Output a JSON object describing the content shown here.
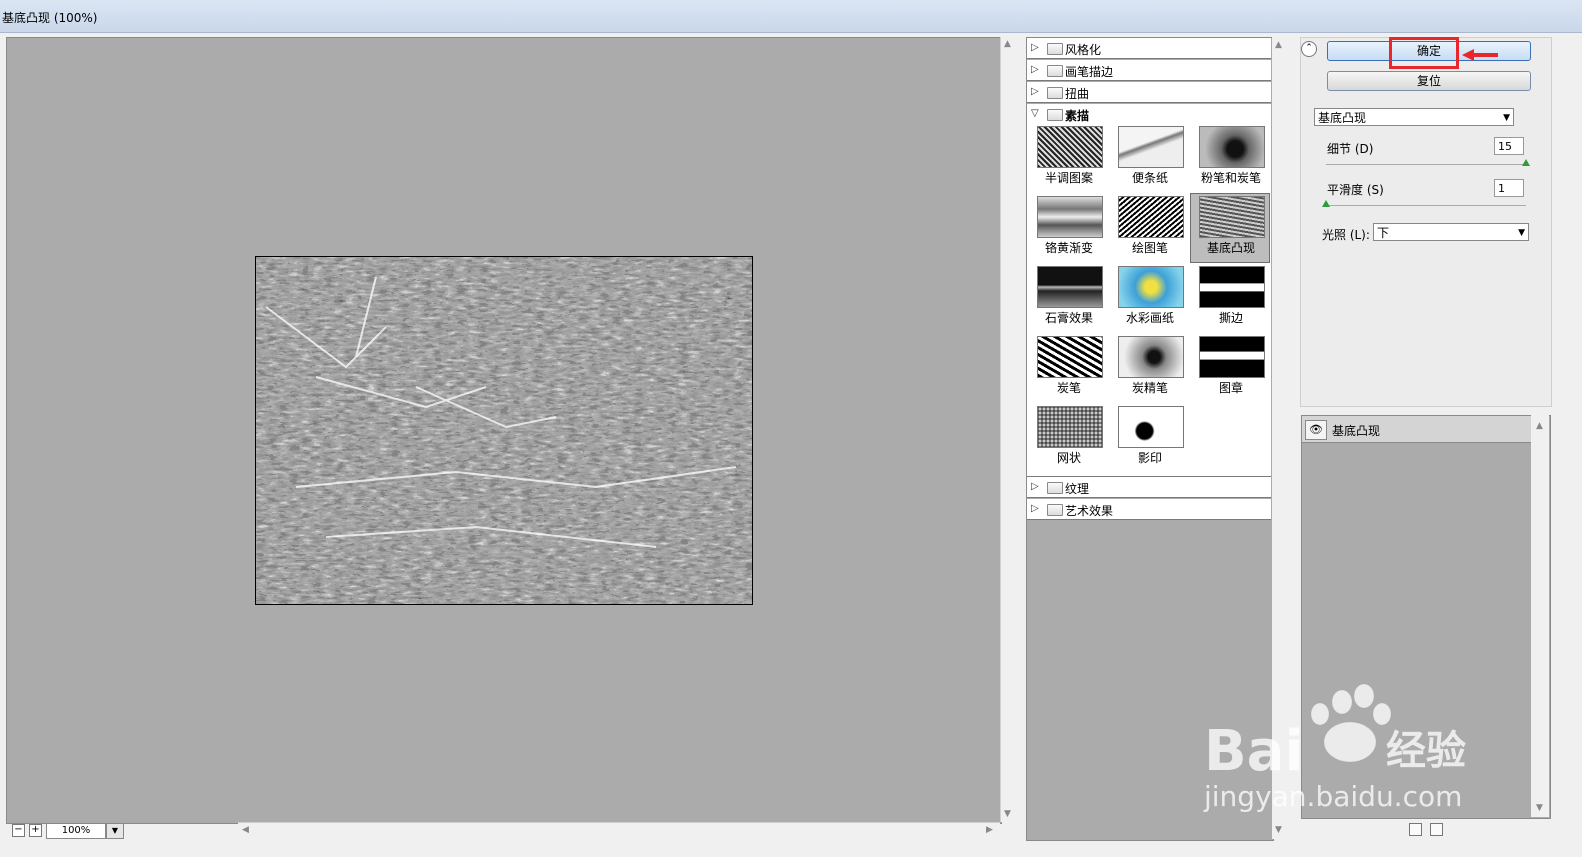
{
  "window": {
    "title": "基底凸现 (100%)"
  },
  "preview": {
    "zoom": "100%"
  },
  "gallery": {
    "categories_top": [
      "风格化",
      "画笔描边",
      "扭曲"
    ],
    "open_category": "素描",
    "thumbnails": [
      {
        "label": "半调图案",
        "icon": "halftone-thumb"
      },
      {
        "label": "便条纸",
        "icon": "notepaper-thumb"
      },
      {
        "label": "粉笔和炭笔",
        "icon": "chalk-charcoal-thumb"
      },
      {
        "label": "铬黄渐变",
        "icon": "chrome-thumb"
      },
      {
        "label": "绘图笔",
        "icon": "graphic-pen-thumb"
      },
      {
        "label": "基底凸现",
        "icon": "bas-relief-thumb",
        "selected": true
      },
      {
        "label": "石膏效果",
        "icon": "plaster-thumb"
      },
      {
        "label": "水彩画纸",
        "icon": "water-paper-thumb"
      },
      {
        "label": "撕边",
        "icon": "torn-edges-thumb"
      },
      {
        "label": "炭笔",
        "icon": "charcoal-thumb"
      },
      {
        "label": "炭精笔",
        "icon": "conte-crayon-thumb"
      },
      {
        "label": "图章",
        "icon": "stamp-thumb"
      },
      {
        "label": "网状",
        "icon": "reticulation-thumb"
      },
      {
        "label": "影印",
        "icon": "photocopy-thumb"
      }
    ],
    "categories_bottom": [
      "纹理",
      "艺术效果"
    ]
  },
  "settings": {
    "ok_label": "确定",
    "reset_label": "复位",
    "filter_select": "基底凸现",
    "detail_label": "细节 (D)",
    "detail_value": "15",
    "detail_fraction": 1.0,
    "smooth_label": "平滑度 (S)",
    "smooth_value": "1",
    "smooth_fraction": 0.0,
    "light_label": "光照 (L):",
    "light_value": "下",
    "highlight_color": "#e8262b"
  },
  "layers": {
    "items": [
      {
        "name": "基底凸现",
        "visible": true
      }
    ]
  },
  "watermark": {
    "brand": "Bai",
    "brand2": "经验",
    "url": "jingyan.baidu.com"
  }
}
